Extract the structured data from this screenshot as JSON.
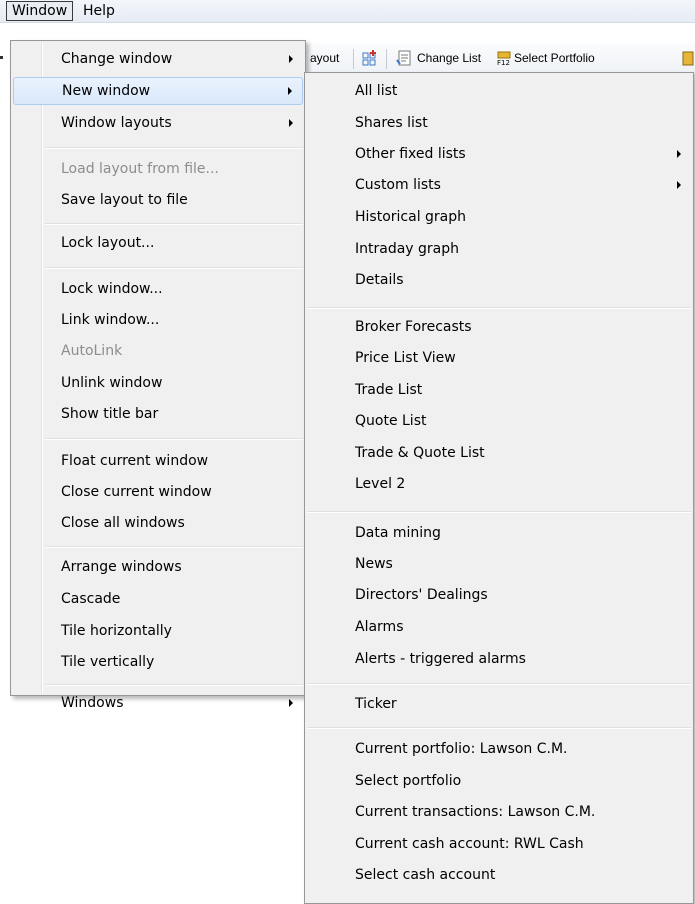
{
  "menubar": {
    "items": [
      "Window",
      "Help"
    ]
  },
  "toolbar": {
    "layout_partial": "ayout",
    "change_list": "Change List",
    "select_portfolio": "Select Portfolio"
  },
  "window_menu": {
    "items": [
      "Change window",
      "New window",
      "Window layouts",
      "Load layout from file...",
      "Save layout to file",
      "Lock layout...",
      "Lock window...",
      "Link window...",
      "AutoLink",
      "Unlink window",
      "Show title bar",
      "Float current window",
      "Close current window",
      "Close all windows",
      "Arrange windows",
      "Cascade",
      "Tile horizontally",
      "Tile vertically",
      "Windows"
    ]
  },
  "new_window_menu": {
    "items": [
      "All list",
      "Shares list",
      "Other fixed lists",
      "Custom lists",
      "Historical graph",
      "Intraday graph",
      "Details",
      "Broker Forecasts",
      "Price List View",
      "Trade List",
      "Quote List",
      "Trade & Quote List",
      "Level 2",
      "Data mining",
      "News",
      "Directors' Dealings",
      "Alarms",
      "Alerts - triggered alarms",
      "Ticker",
      "Current portfolio: Lawson C.M.",
      "Select portfolio",
      "Current transactions: Lawson C.M.",
      "Current cash account: RWL Cash",
      "Select cash account"
    ]
  },
  "colors": {
    "menu_bg": "#f0f0f0",
    "highlight_border": "#aecbf1",
    "disabled_text": "#8d8d8d"
  }
}
